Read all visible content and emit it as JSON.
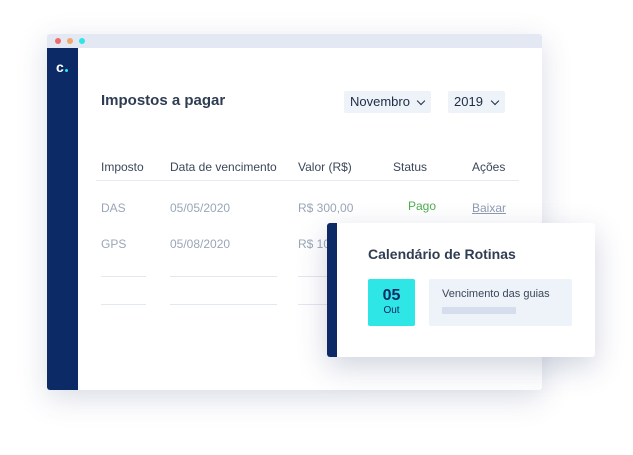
{
  "app": {
    "logo_text": "c"
  },
  "page": {
    "title": "Impostos a pagar"
  },
  "filters": {
    "month": "Novembro",
    "year": "2019"
  },
  "table": {
    "headers": [
      "Imposto",
      "Data de vencimento",
      "Valor (R$)",
      "Status",
      "Ações"
    ],
    "rows": [
      {
        "tax": "DAS",
        "due_date": "05/05/2020",
        "value": "R$ 300,00",
        "status": "Pago",
        "action": "Baixar"
      },
      {
        "tax": "GPS",
        "due_date": "05/08/2020",
        "value": "R$ 10",
        "status": "",
        "action": ""
      }
    ]
  },
  "calendar_card": {
    "title": "Calendário de Rotinas",
    "date_day": "05",
    "date_month": "Out",
    "routine_label": "Vencimento das guias"
  },
  "colors": {
    "navy": "#0c2b66",
    "cyan": "#2ee6e6",
    "paid_green": "#4caf50"
  },
  "icons": {
    "window_controls": [
      "close-dot-icon",
      "minimize-dot-icon",
      "maximize-dot-icon"
    ],
    "select_arrow": "chevron-down-icon"
  }
}
